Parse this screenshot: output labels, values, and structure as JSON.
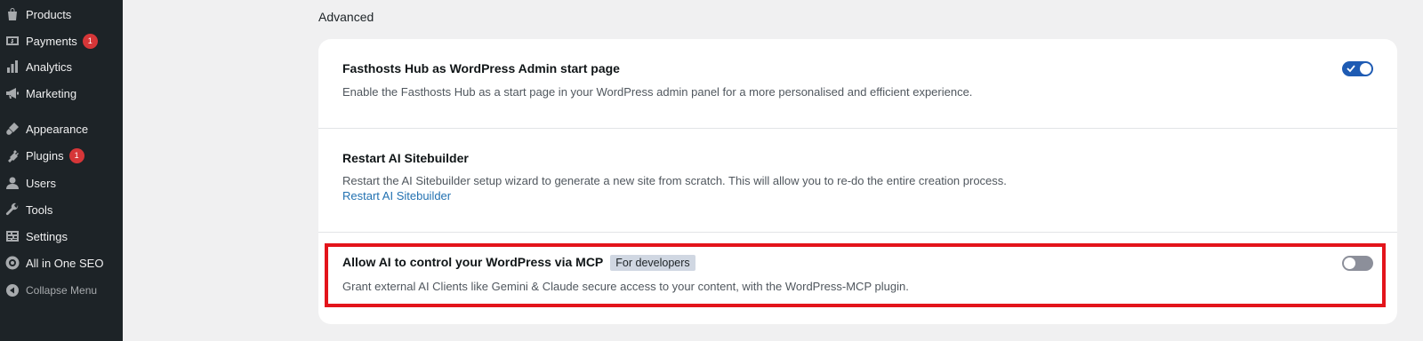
{
  "sidebar": {
    "items": [
      {
        "label": "Products",
        "icon": "products-icon",
        "badge": ""
      },
      {
        "label": "Payments",
        "icon": "payments-icon",
        "badge": "1"
      },
      {
        "label": "Analytics",
        "icon": "analytics-icon",
        "badge": ""
      },
      {
        "label": "Marketing",
        "icon": "marketing-icon",
        "badge": ""
      },
      {
        "label": "Appearance",
        "icon": "appearance-icon",
        "badge": ""
      },
      {
        "label": "Plugins",
        "icon": "plugins-icon",
        "badge": "1"
      },
      {
        "label": "Users",
        "icon": "users-icon",
        "badge": ""
      },
      {
        "label": "Tools",
        "icon": "tools-icon",
        "badge": ""
      },
      {
        "label": "Settings",
        "icon": "settings-icon",
        "badge": ""
      },
      {
        "label": "All in One SEO",
        "icon": "seo-icon",
        "badge": ""
      }
    ],
    "collapse_label": "Collapse Menu"
  },
  "main": {
    "section_title": "Advanced",
    "settings": [
      {
        "title": "Fasthosts Hub as WordPress Admin start page",
        "description": "Enable the Fasthosts Hub as a start page in your WordPress admin panel for a more personalised and efficient experience.",
        "enabled": true
      },
      {
        "title": "Restart AI Sitebuilder",
        "description": "Restart the AI Sitebuilder setup wizard to generate a new site from scratch. This will allow you to re-do the entire creation process.",
        "link": "Restart AI Sitebuilder"
      },
      {
        "title": "Allow AI to control your WordPress via MCP",
        "tag": "For developers",
        "description": "Grant external AI Clients like Gemini & Claude secure access to your content, with the WordPress-MCP plugin.",
        "enabled": false
      }
    ]
  },
  "colors": {
    "sidebar_bg": "#1d2327",
    "accent": "#1e5bb3",
    "highlight": "#e3141b",
    "badge": "#d63638"
  }
}
